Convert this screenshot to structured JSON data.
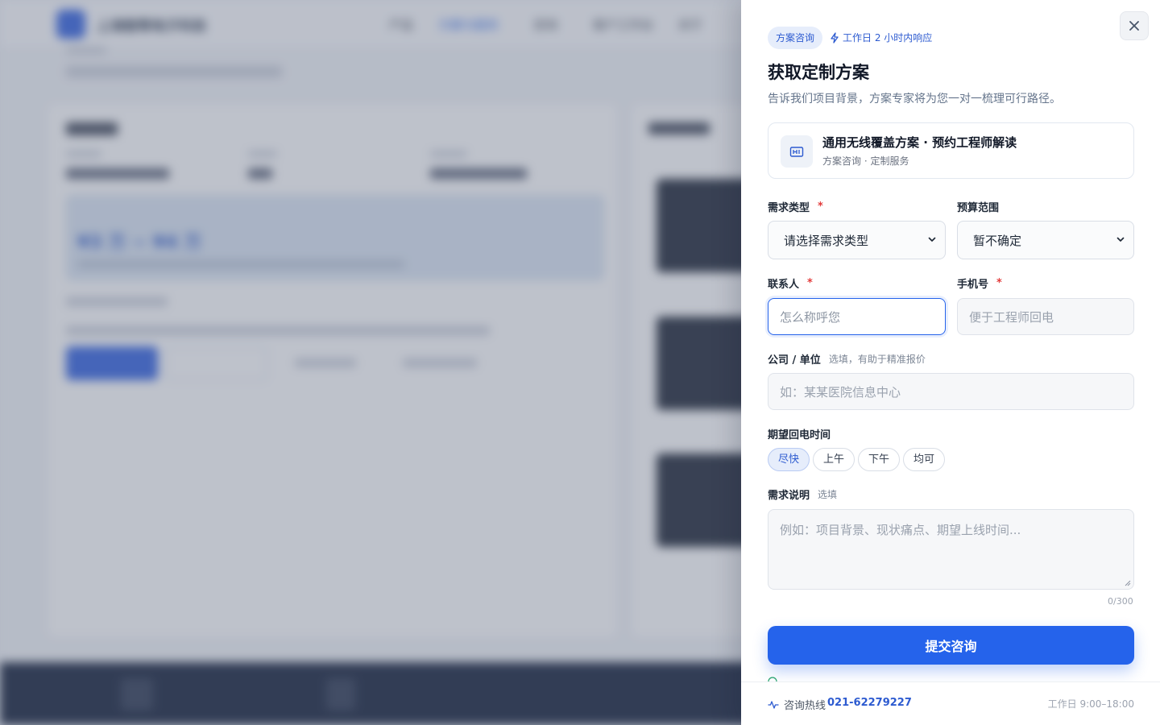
{
  "background": {
    "brand": "上海智帮电子科技",
    "menu": [
      "产品",
      "方案与服务",
      "咨询",
      "客户工作台",
      "关于"
    ]
  },
  "drawer": {
    "badge": "方案咨询",
    "sla": "工作日 2 小时内响应",
    "title": "获取定制方案",
    "subtitle": "告诉我们项目背景，方案专家将为您一对一梳理可行路径。",
    "product": {
      "name": "通用无线覆盖方案 · 预约工程师解读",
      "meta": "方案咨询 · 定制服务"
    },
    "form": {
      "need_type": {
        "label": "需求类型",
        "required": "*",
        "value": "请选择需求类型"
      },
      "budget": {
        "label": "预算范围",
        "value": "暂不确定"
      },
      "contact": {
        "label": "联系人",
        "required": "*",
        "placeholder": "怎么称呼您"
      },
      "phone": {
        "label": "手机号",
        "required": "*",
        "placeholder": "便于工程师回电"
      },
      "company": {
        "label": "公司 / 单位",
        "hint": "选填，有助于精准报价",
        "placeholder": "如：某某医院信息中心"
      },
      "callback": {
        "label": "期望回电时间",
        "options": [
          "尽快",
          "上午",
          "下午",
          "均可"
        ],
        "selected": "尽快"
      },
      "notes": {
        "label": "需求说明",
        "hint": "选填",
        "placeholder": "例如：项目背景、现状痛点、期望上线时间...",
        "counter": "0/300"
      }
    },
    "submit_label": "提交咨询",
    "footer": {
      "hotline_label": "咨询热线",
      "hotline_number": "021-62279227",
      "hours": "工作日 9:00–18:00"
    }
  },
  "colors": {
    "accent": "#2563eb",
    "badge_bg": "#e6edfb",
    "required": "#e23b3b"
  }
}
